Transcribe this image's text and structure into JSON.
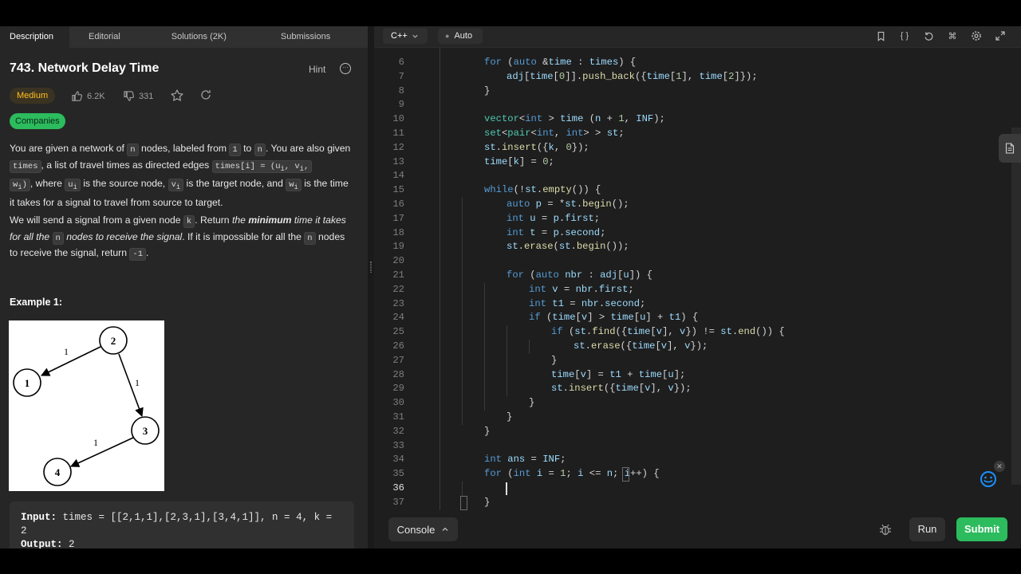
{
  "left_tabs": [
    "Description",
    "Editorial",
    "Solutions (2K)",
    "Submissions"
  ],
  "problem": {
    "title": "743. Network Delay Time",
    "hint": "Hint",
    "difficulty": "Medium",
    "likes": "6.2K",
    "dislikes": "331",
    "companies": "Companies"
  },
  "desc": {
    "p1_a": "You are given a network of ",
    "p1_n": "n",
    "p1_b": " nodes, labeled from ",
    "p1_one": "1",
    "p1_c": " to ",
    "p1_n2": "n",
    "p1_d": ". You are also given ",
    "p1_times": "times",
    "p1_e": ", a list of travel times as directed edges ",
    "p1_edge1": "times[i] = (u",
    "p1_sub_i1": "i",
    "p1_edge2": ", v",
    "p1_sub_i2": "i",
    "p1_edge3": ",",
    "p1_edge4": "w",
    "p1_sub_i3": "i",
    "p1_edge5": ")",
    "p1_f": ", where ",
    "p1_u": "u",
    "p1_sub_u": "i",
    "p1_g": " is the source node, ",
    "p1_v": "v",
    "p1_sub_v": "i",
    "p1_h": " is the target node, and ",
    "p1_w": "w",
    "p1_sub_w": "i",
    "p1_i": " is the time it takes for a signal to travel from source to target.",
    "p2_a": "We will send a signal from a given node ",
    "p2_k": "k",
    "p2_b": ". Return ",
    "p2_c": "the ",
    "p2_d": "minimum",
    "p2_e": " time it takes for all the ",
    "p2_n": "n",
    "p2_f": " nodes to receive the signal",
    "p2_g": ". If it is impossible for all the ",
    "p2_n2": "n",
    "p2_h": " nodes to receive the signal, return ",
    "p2_neg": "-1",
    "p2_i": "."
  },
  "example": {
    "title": "Example 1:",
    "graph_nodes": [
      "1",
      "2",
      "3",
      "4"
    ],
    "graph_edge_labels": [
      "1",
      "1",
      "1"
    ],
    "input_label": "Input:",
    "input_value": " times = [[2,1,1],[2,3,1],[3,4,1]], n = 4, k =",
    "input_value2": "2",
    "output_label": "Output:",
    "output_value": " 2"
  },
  "editor": {
    "language": "C++",
    "mode": "Auto",
    "toolbar_icons": [
      "bookmark-icon",
      "braces-icon",
      "reset-icon",
      "command-icon",
      "settings-icon",
      "expand-icon"
    ],
    "cursor_line": "36",
    "lines": [
      {
        "n": "6",
        "indent": 1,
        "code": "for (auto &time : times) {"
      },
      {
        "n": "7",
        "indent": 2,
        "code": "adj[time[0]].push_back({time[1], time[2]});"
      },
      {
        "n": "8",
        "indent": 1,
        "code": "}"
      },
      {
        "n": "9",
        "indent": 0,
        "code": ""
      },
      {
        "n": "10",
        "indent": 1,
        "code": "vector<int > time (n + 1, INF);"
      },
      {
        "n": "11",
        "indent": 1,
        "code": "set<pair<int, int> > st;"
      },
      {
        "n": "12",
        "indent": 1,
        "code": "st.insert({k, 0});"
      },
      {
        "n": "13",
        "indent": 1,
        "code": "time[k] = 0;"
      },
      {
        "n": "14",
        "indent": 0,
        "code": ""
      },
      {
        "n": "15",
        "indent": 1,
        "code": "while(!st.empty()) {"
      },
      {
        "n": "16",
        "indent": 2,
        "code": "auto p = *st.begin();"
      },
      {
        "n": "17",
        "indent": 2,
        "code": "int u = p.first;"
      },
      {
        "n": "18",
        "indent": 2,
        "code": "int t = p.second;"
      },
      {
        "n": "19",
        "indent": 2,
        "code": "st.erase(st.begin());"
      },
      {
        "n": "20",
        "indent": 0,
        "code": ""
      },
      {
        "n": "21",
        "indent": 2,
        "code": "for (auto nbr : adj[u]) {"
      },
      {
        "n": "22",
        "indent": 3,
        "code": "int v = nbr.first;"
      },
      {
        "n": "23",
        "indent": 3,
        "code": "int t1 = nbr.second;"
      },
      {
        "n": "24",
        "indent": 3,
        "code": "if (time[v] > time[u] + t1) {"
      },
      {
        "n": "25",
        "indent": 4,
        "code": "if (st.find({time[v], v}) != st.end()) {"
      },
      {
        "n": "26",
        "indent": 5,
        "code": "st.erase({time[v], v});"
      },
      {
        "n": "27",
        "indent": 4,
        "code": "}"
      },
      {
        "n": "28",
        "indent": 4,
        "code": "time[v] = t1 + time[u];"
      },
      {
        "n": "29",
        "indent": 4,
        "code": "st.insert({time[v], v});"
      },
      {
        "n": "30",
        "indent": 3,
        "code": "}"
      },
      {
        "n": "31",
        "indent": 2,
        "code": "}"
      },
      {
        "n": "32",
        "indent": 1,
        "code": "}"
      },
      {
        "n": "33",
        "indent": 0,
        "code": ""
      },
      {
        "n": "34",
        "indent": 1,
        "code": "int ans = INF;"
      },
      {
        "n": "35",
        "indent": 1,
        "code": "for (int i = 1; i <= n; i++) {"
      },
      {
        "n": "36",
        "indent": 0,
        "code": ""
      },
      {
        "n": "37",
        "indent": 1,
        "code": "}"
      }
    ]
  },
  "bottom": {
    "console": "Console",
    "run": "Run",
    "submit": "Submit"
  },
  "colors": {
    "accent_green": "#2cbb5d",
    "medium_yellow": "#ffc01e",
    "feedback_blue": "#1a90ff"
  }
}
